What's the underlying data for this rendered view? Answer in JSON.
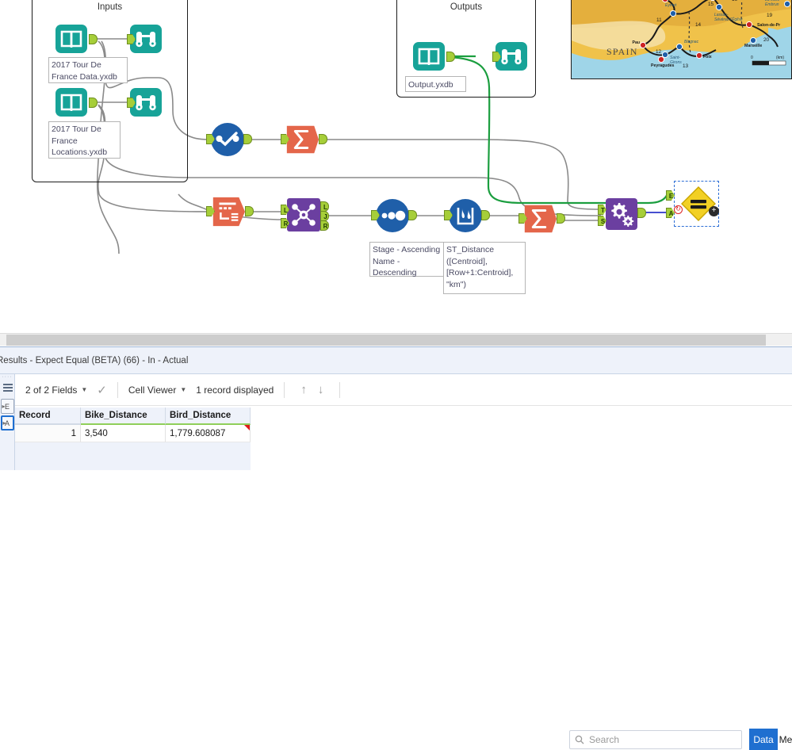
{
  "canvas": {
    "containers": [
      {
        "name": "inputs",
        "title": "Inputs"
      },
      {
        "name": "outputs",
        "title": "Outputs"
      }
    ],
    "annotations": [
      {
        "name": "input-data-label",
        "text": "2017 Tour De France Data.yxdb"
      },
      {
        "name": "input-locations-label",
        "text": "2017 Tour De France Locations.yxdb"
      },
      {
        "name": "output-label",
        "text": "Output.yxdb"
      },
      {
        "name": "sort-annotation",
        "text": "Stage - Ascending Name - Descending"
      },
      {
        "name": "formula-annotation",
        "text": "ST_Distance ([Centroid], [Row+1:Centroid], \"km\")"
      }
    ],
    "tools": [
      {
        "name": "input-data-tool",
        "icon": "book-icon",
        "color": "#17a398"
      },
      {
        "name": "browse-data-tool",
        "icon": "binoculars-icon",
        "color": "#17a398"
      },
      {
        "name": "input-locations-tool",
        "icon": "book-icon",
        "color": "#17a398"
      },
      {
        "name": "browse-locations-tool",
        "icon": "binoculars-icon",
        "color": "#17a398"
      },
      {
        "name": "output-tool",
        "icon": "book-icon",
        "color": "#17a398"
      },
      {
        "name": "browse-output-tool",
        "icon": "binoculars-icon",
        "color": "#17a398"
      },
      {
        "name": "select-tool",
        "icon": "checkmark-circle-icon",
        "color": "#1f5fa9"
      },
      {
        "name": "summarize-tool-top",
        "icon": "sigma-icon",
        "color": "#e4664a"
      },
      {
        "name": "transform-tool",
        "icon": "transform-icon",
        "color": "#e4664a"
      },
      {
        "name": "join-tool",
        "icon": "join-icon",
        "color": "#6b3fa0",
        "ports": [
          "L",
          "J",
          "R"
        ]
      },
      {
        "name": "sort-tool",
        "icon": "three-dots-icon",
        "color": "#1f5fa9"
      },
      {
        "name": "formula-tool",
        "icon": "beaker-icon",
        "color": "#1f5fa9"
      },
      {
        "name": "summarize-tool-bottom",
        "icon": "sigma-icon",
        "color": "#e4664a"
      },
      {
        "name": "gears-tool",
        "icon": "gears-icon",
        "color": "#6b3fa0",
        "ports": [
          "T",
          "S"
        ]
      },
      {
        "name": "expect-equal-tool",
        "icon": "equals-diamond-icon",
        "color": "#f2d024",
        "ports": [
          "E",
          "A"
        ]
      }
    ],
    "map": {
      "name": "tour-route-map",
      "label_spain": "SPAIN",
      "scale_zero": "0",
      "scale_unit": "(km)"
    }
  },
  "results": {
    "title": "Results - Expect Equal (BETA) (66) - In - Actual",
    "rail": {
      "list_icon": "list-icon",
      "port_e": "E",
      "port_a": "A"
    },
    "toolbar": {
      "fields": "2 of 2 Fields",
      "viewer": "Cell Viewer",
      "records": "1 record displayed",
      "up_arrow": "↑",
      "down_arrow": "↓",
      "check": "✓"
    },
    "search": {
      "placeholder": "Search",
      "icon": "search-icon"
    },
    "tabs": [
      {
        "name": "tab-data",
        "label": "Data",
        "active": true
      },
      {
        "name": "tab-metadata",
        "label": "Me",
        "active": false
      }
    ],
    "grid": {
      "columns": [
        "Record",
        "Bike_Distance",
        "Bird_Distance"
      ],
      "rows": [
        {
          "record": "1",
          "bike_distance": "3,540",
          "bird_distance": "1,779.608087"
        }
      ]
    }
  },
  "colors": {
    "teal": "#17a398",
    "orange": "#e4664a",
    "blue": "#1f5fa9",
    "purple": "#6b3fa0",
    "yellow": "#f2d024",
    "green_wire": "#1b9e3f",
    "gray_wire": "#8a8a8a",
    "accent_blue": "#1f6fd0"
  }
}
